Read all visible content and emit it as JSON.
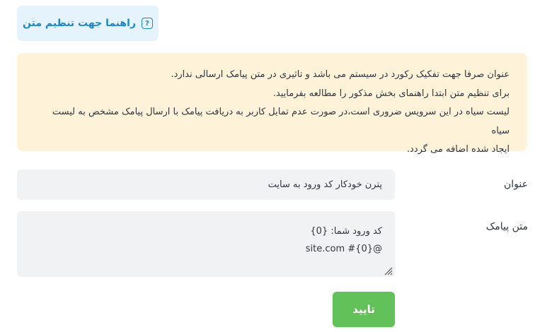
{
  "help": {
    "label": "راهنما جهت تنظیم متن",
    "icon": "question-icon",
    "icon_glyph": "?"
  },
  "notice": {
    "lines": [
      "عنوان صرفا جهت تفکیک رکورد در سیستم می باشد و تاثیری در متن پیامک ارسالی ندارد.",
      "برای تنظیم متن ابتدا راهنمای بخش مذکور را مطالعه بفرمایید.",
      "لیست سیاه در این سرویس ضروری است،در صورت عدم تمایل کاربر به دریافت پیامک با ارسال پیامک مشخص به لیست سیاه",
      "ایجاد شده اضافه می گردد."
    ]
  },
  "form": {
    "title_label": "عنوان",
    "title_value": "پترن خودکار کد ورود به سایت",
    "message_label": "متن پیامک",
    "message_lines": [
      "کد ورود شما: {0}",
      "@site.com #{0}"
    ],
    "submit_label": "تایید"
  },
  "colors": {
    "help_bg": "#e5f3fd",
    "help_text": "#1f86c6",
    "notice_bg": "#fef3d9",
    "input_bg": "#f1f2f4",
    "submit_bg": "#62c159"
  }
}
